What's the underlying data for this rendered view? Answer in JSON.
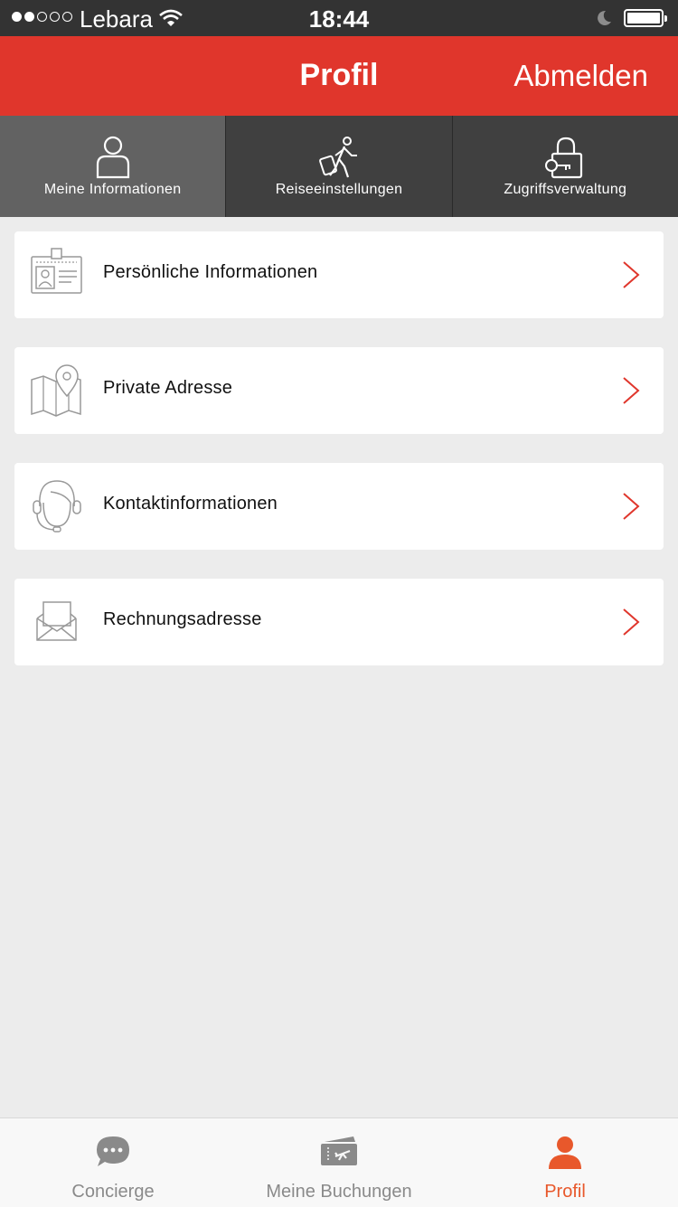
{
  "status_bar": {
    "carrier": "Lebara",
    "time": "18:44",
    "signal_bars_filled": 2,
    "signal_bars_total": 5
  },
  "header": {
    "title": "Profil",
    "logout_label": "Abmelden"
  },
  "segments": [
    {
      "label": "Meine Informationen",
      "icon": "person-icon",
      "active": true
    },
    {
      "label": "Reiseeinstellungen",
      "icon": "traveler-icon",
      "active": false
    },
    {
      "label": "Zugriffsverwaltung",
      "icon": "lock-key-icon",
      "active": false
    }
  ],
  "menu": [
    {
      "label": "Persönliche Informationen",
      "icon": "id-card-icon"
    },
    {
      "label": "Private Adresse",
      "icon": "map-pin-icon"
    },
    {
      "label": "Kontaktinformationen",
      "icon": "headset-agent-icon"
    },
    {
      "label": "Rechnungsadresse",
      "icon": "envelope-icon"
    }
  ],
  "bottom_tabs": [
    {
      "label": "Concierge",
      "icon": "chat-bubble-icon",
      "active": false
    },
    {
      "label": "Meine Buchungen",
      "icon": "ticket-plane-icon",
      "active": false
    },
    {
      "label": "Profil",
      "icon": "profile-icon",
      "active": true
    }
  ],
  "colors": {
    "brand_red": "#e0362c",
    "accent_orange": "#e8582b",
    "tab_dark": "#404040",
    "tab_active": "#626262",
    "background": "#ececec"
  }
}
